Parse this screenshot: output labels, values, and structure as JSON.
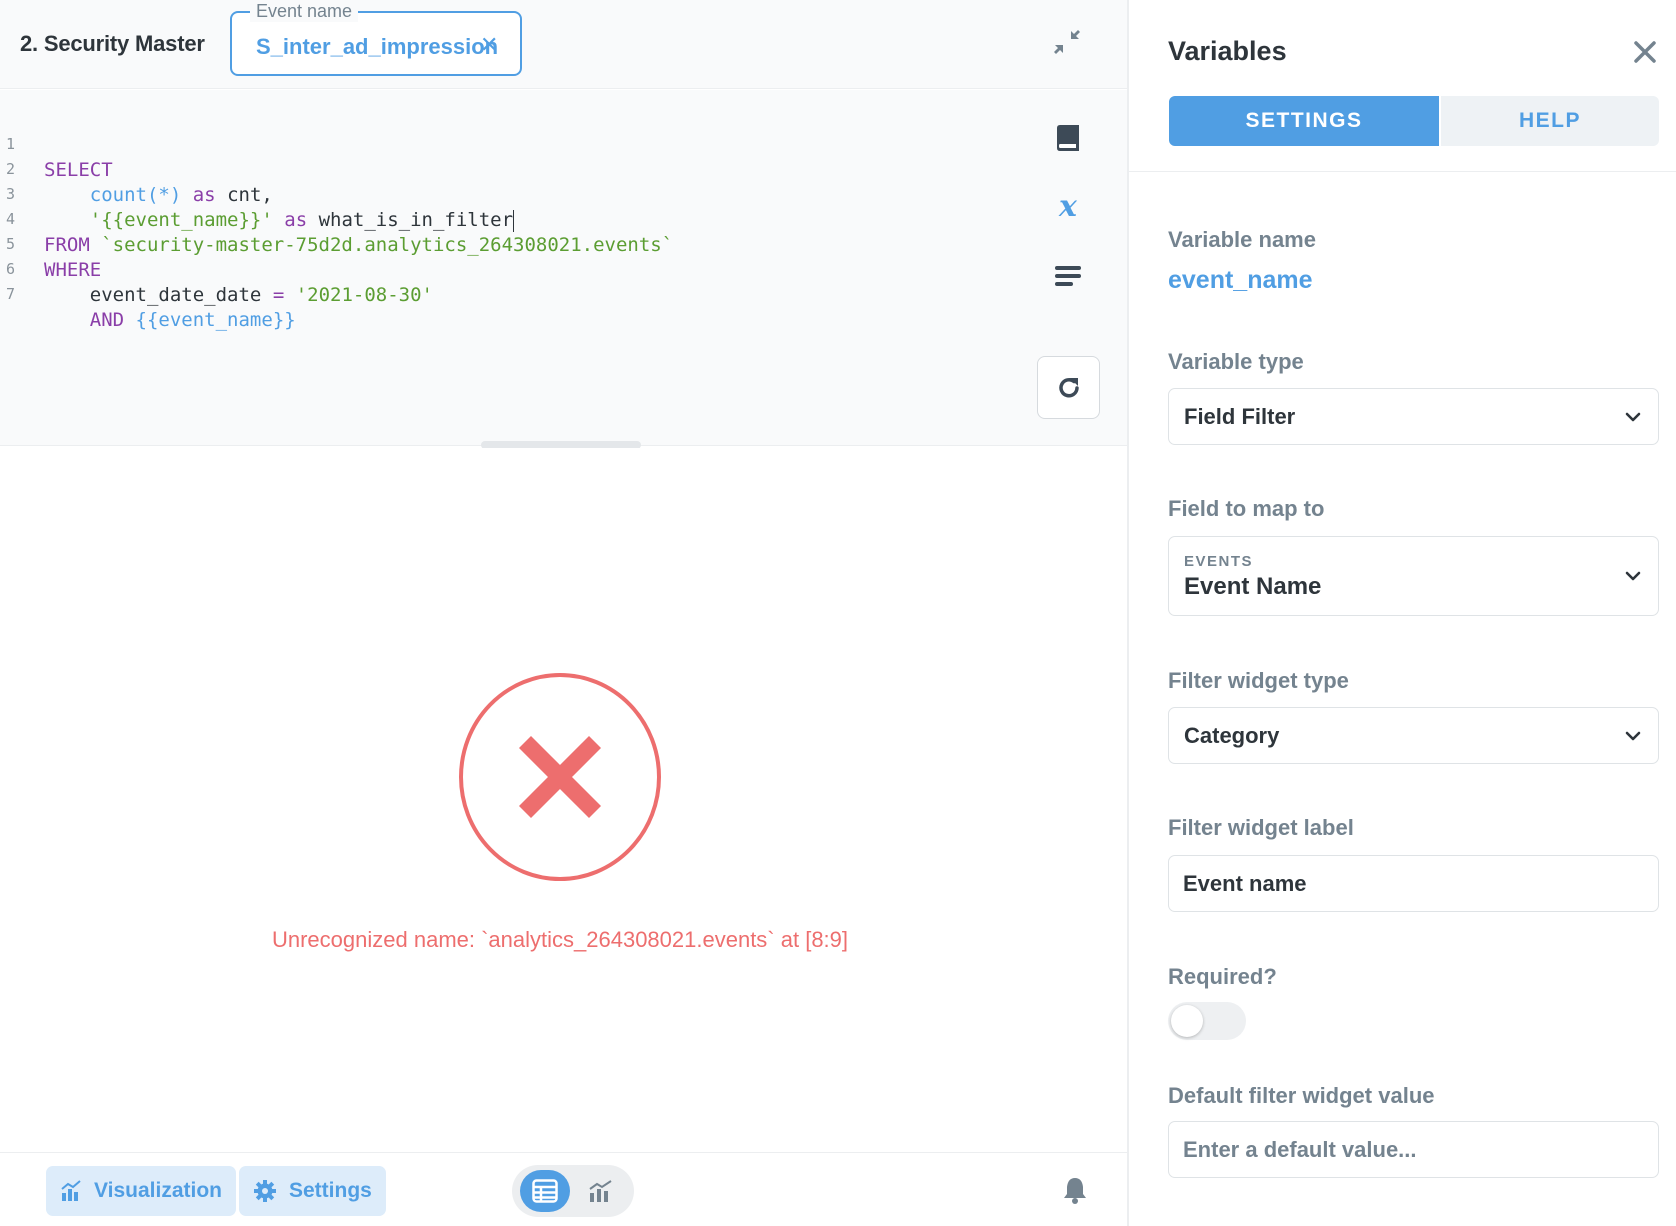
{
  "header": {
    "database_name": "2. Security Master",
    "parameter": {
      "label": "Event name",
      "value": "S_inter_ad_impression",
      "clear_glyph": "✕"
    }
  },
  "editor": {
    "lines": [
      {
        "n": "1"
      },
      {
        "n": "2"
      },
      {
        "n": "3"
      },
      {
        "n": "4"
      },
      {
        "n": "5"
      },
      {
        "n": "6"
      },
      {
        "n": "7"
      }
    ],
    "tokens": {
      "l1_kw": "SELECT",
      "l2_fn": "count(*)",
      "l2_as": "as",
      "l2_alias": "cnt,",
      "l3_str": "'{{event_name}}'",
      "l3_as": "as",
      "l3_alias": "what_is_in_filter",
      "l4_kw": "FROM",
      "l4_str": "`security-master-75d2d.analytics_264308021.events`",
      "l5_kw": "WHERE",
      "l6_col": "event_date_date",
      "l6_eq": "=",
      "l6_str": "'2021-08-30'",
      "l7_kw": "AND",
      "l7_tpl": "{{event_name}}"
    },
    "side_tools": [
      "data-reference-icon",
      "variables-icon",
      "snippets-icon"
    ]
  },
  "result": {
    "error_message": "Unrecognized name: `analytics_264308021.events` at [8:9]"
  },
  "footer": {
    "visualization_label": "Visualization",
    "settings_label": "Settings",
    "view_toggle": [
      "table-view-icon",
      "chart-view-icon"
    ],
    "active_view": "table-view-icon"
  },
  "sidebar": {
    "title": "Variables",
    "tabs": {
      "settings": "SETTINGS",
      "help": "HELP"
    },
    "active_tab": "settings",
    "variable_name_label": "Variable name",
    "variable_name": "event_name",
    "variable_type_label": "Variable type",
    "variable_type": "Field Filter",
    "field_map_label": "Field to map to",
    "field_map_table": "EVENTS",
    "field_map_field": "Event Name",
    "widget_type_label": "Filter widget type",
    "widget_type": "Category",
    "widget_label_label": "Filter widget label",
    "widget_label_value": "Event name",
    "required_label": "Required?",
    "required": false,
    "default_label": "Default filter widget value",
    "default_placeholder": "Enter a default value..."
  },
  "colors": {
    "brand": "#509ee3",
    "error": "#ed6e6e",
    "text": "#2e353b",
    "muted": "#74838f",
    "keyword": "#8a3ea8",
    "string": "#5b9d32"
  }
}
